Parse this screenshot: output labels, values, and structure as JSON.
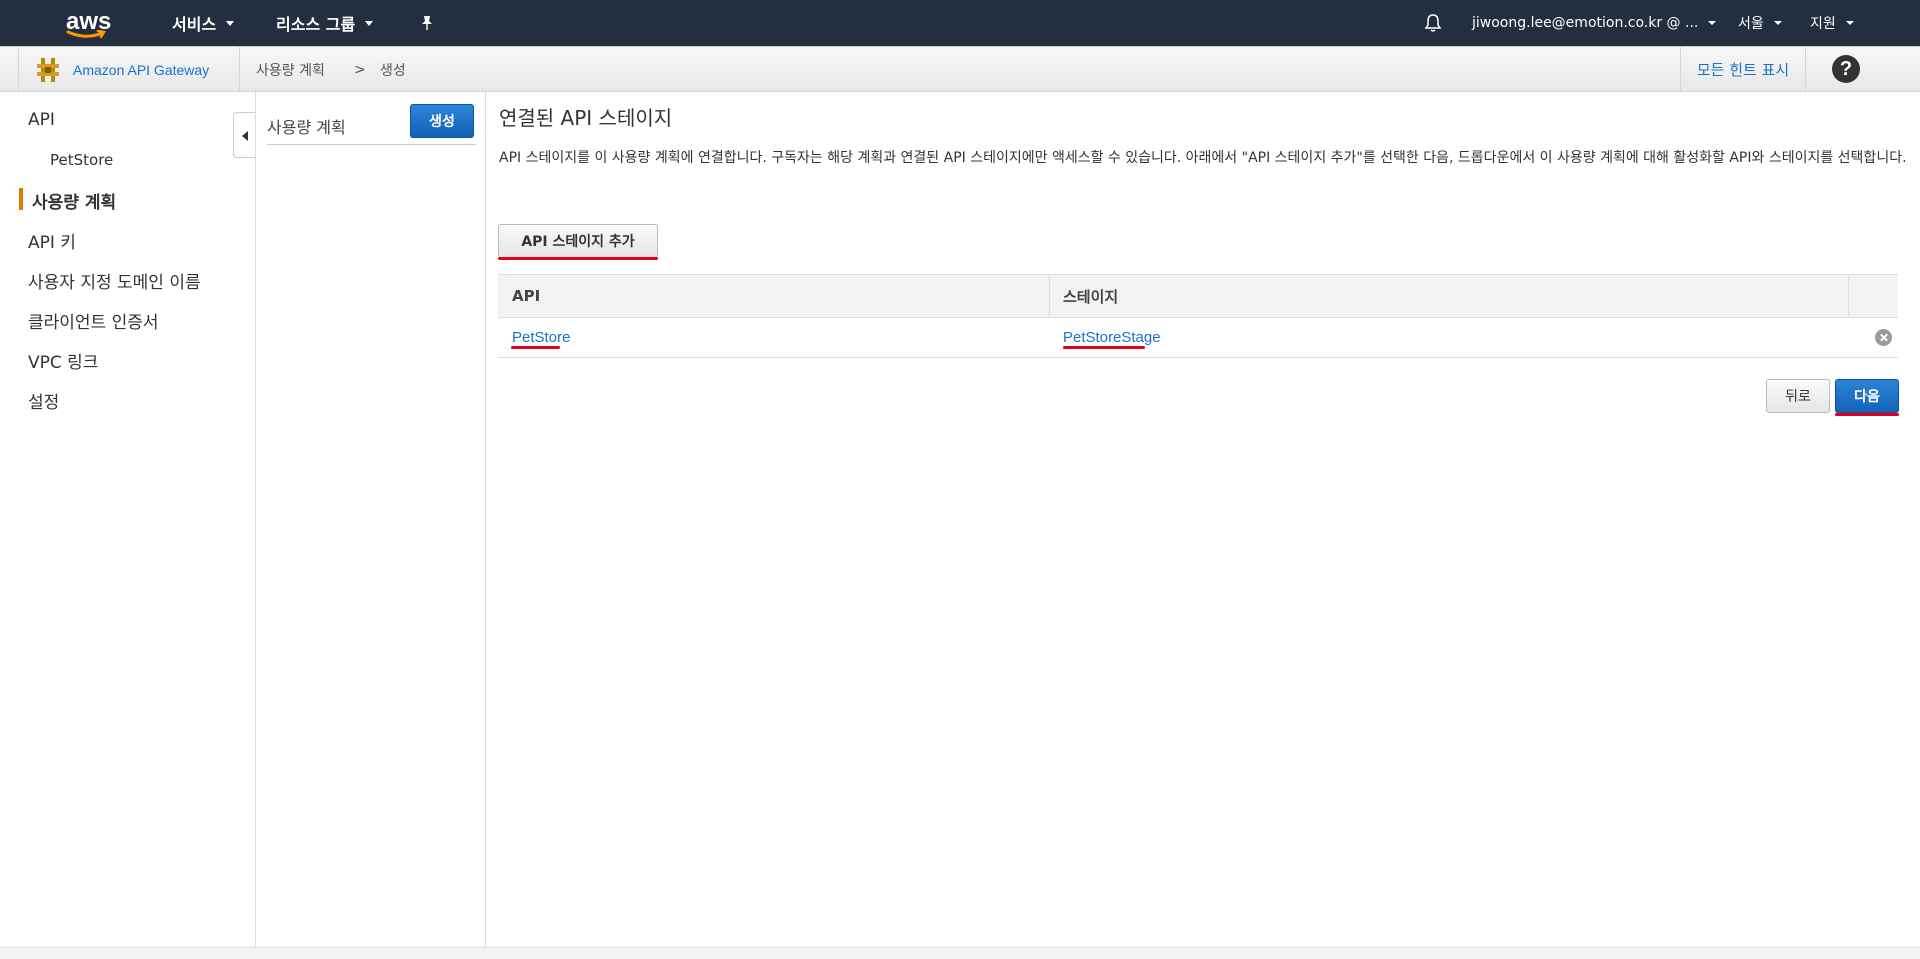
{
  "topnav": {
    "logo_text": "aws",
    "services": "서비스",
    "resource_groups": "리소스 그룹",
    "account": "jiwoong.lee@emotion.co.kr @ ...",
    "region": "서울",
    "support": "지원"
  },
  "subbar": {
    "service_name": "Amazon API Gateway",
    "breadcrumb": [
      "사용량 계획",
      ">",
      "생성"
    ],
    "show_hints": "모든 힌트 표시",
    "help": "?"
  },
  "leftnav": {
    "items": [
      {
        "label": "API"
      },
      {
        "label": "PetStore"
      },
      {
        "label": "사용량 계획"
      },
      {
        "label": "API 키"
      },
      {
        "label": "사용자 지정 도메인 이름"
      },
      {
        "label": "클라이언트 인증서"
      },
      {
        "label": "VPC 링크"
      },
      {
        "label": "설정"
      }
    ]
  },
  "midcol": {
    "title": "사용량 계획",
    "create_label": "생성"
  },
  "main": {
    "title": "연결된 API 스테이지",
    "description": "API 스테이지를 이 사용량 계획에 연결합니다. 구독자는 해당 계획과 연결된 API 스테이지에만 액세스할 수 있습니다. 아래에서 \"API 스테이지 추가\"를 선택한 다음, 드롭다운에서 이 사용량 계획에 대해 활성화할 API와 스테이지를 선택합니다.",
    "add_stage_label": "API 스테이지 추가",
    "table": {
      "headers": [
        "API",
        "스테이지"
      ],
      "rows": [
        {
          "api": "PetStore",
          "stage": "PetStoreStage"
        }
      ]
    },
    "back_label": "뒤로",
    "next_label": "다음"
  },
  "colors": {
    "topnav_bg": "#232f3e",
    "link": "#1a73c9",
    "primary_button": "#1a6fc8",
    "active_indicator": "#e07b00",
    "annotation_underline": "#e3001b"
  }
}
